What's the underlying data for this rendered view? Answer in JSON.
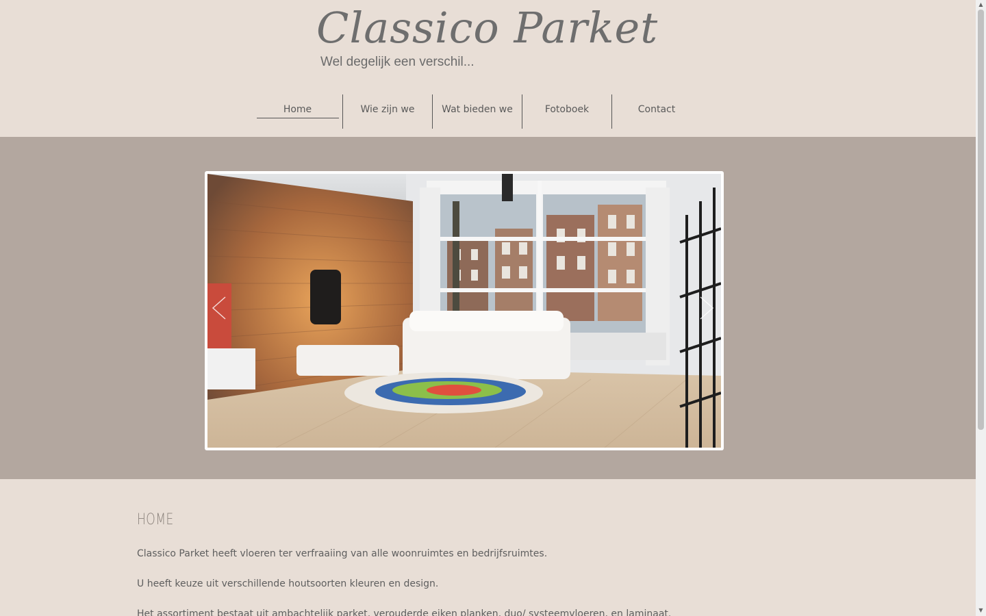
{
  "brand": {
    "title": "Classico Parket",
    "tagline": "Wel degelijk een verschil..."
  },
  "nav": {
    "items": [
      {
        "label": "Home",
        "active": true
      },
      {
        "label": "Wie zijn we"
      },
      {
        "label": "Wat bieden we"
      },
      {
        "label": "Fotoboek"
      },
      {
        "label": "Contact"
      }
    ]
  },
  "slider": {
    "prev_icon": "chevron-left-icon",
    "next_icon": "chevron-right-icon"
  },
  "main": {
    "title": "HOME",
    "paragraphs": [
      "Classico Parket heeft vloeren ter verfraaiing van alle woonruimtes en bedrijfsruimtes.",
      "U heeft keuze uit verschillende houtsoorten kleuren en design.",
      "Het assortiment bestaat uit ambachtelijk parket, verouderde eiken planken, duo/ systeemvloeren, en laminaat."
    ]
  },
  "colors": {
    "page_bg": "#e8ded6",
    "hero_bg": "#b3a79f",
    "text": "#5e5e5e",
    "title_muted": "#8a817b"
  }
}
